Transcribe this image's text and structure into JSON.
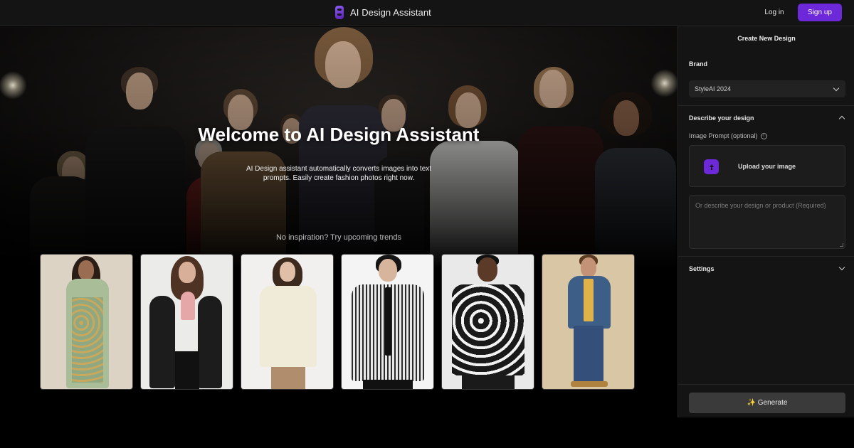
{
  "header": {
    "app_name": "AI Design Assistant",
    "login_label": "Log in",
    "signup_label": "Sign up",
    "accent_color": "#6d28d9"
  },
  "hero": {
    "title": "Welcome to AI Design Assistant",
    "subtitle": "AI Design assistant automatically converts images into text prompts. Easily create fashion photos right now.",
    "inspiration_text": "No inspiration? Try upcoming trends",
    "trend_cards": [
      {
        "id": "floral-dress",
        "icon": "floral-wrap-dress"
      },
      {
        "id": "leather-jacket",
        "icon": "black-leather-jacket"
      },
      {
        "id": "cream-sweater",
        "icon": "cream-polo-sweater"
      },
      {
        "id": "striped-shirt",
        "icon": "striped-shirt-tie"
      },
      {
        "id": "floral-shirt",
        "icon": "black-floral-shirt"
      },
      {
        "id": "denim-jacket",
        "icon": "denim-jacket-jeans"
      }
    ]
  },
  "panel": {
    "title": "Create New Design",
    "brand_label": "Brand",
    "brand_value": "StyleAI 2024",
    "describe_label": "Describe your design",
    "image_prompt_label": "Image Prompt (optional)",
    "upload_label": "Upload your image",
    "description_placeholder": "Or describe your design or product (Required)",
    "settings_label": "Settings",
    "generate_label": "✨ Generate"
  }
}
